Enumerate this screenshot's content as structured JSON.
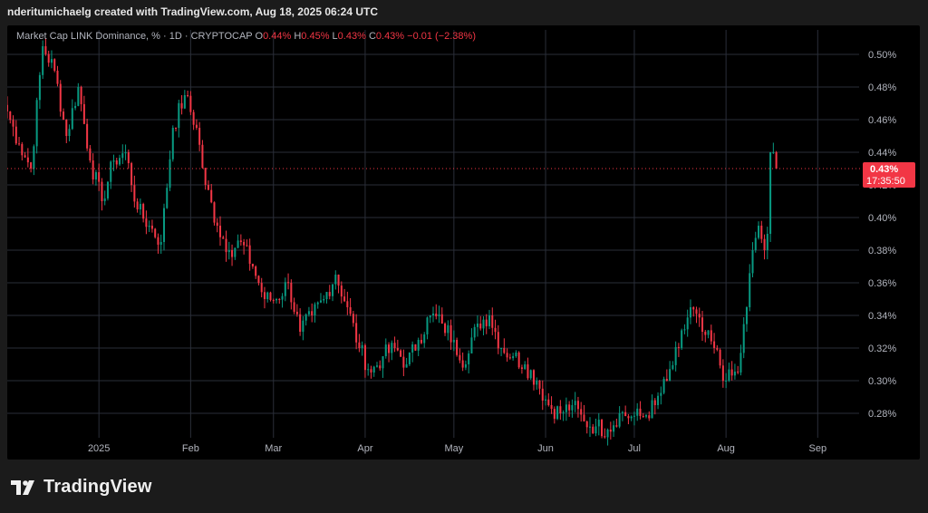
{
  "caption": "nderitumichaelg created with TradingView.com, Aug 18, 2025 06:24 UTC",
  "legend": {
    "symbol": "Market Cap LINK Dominance, % · 1D · CRYPTOCAP",
    "o_label": "O",
    "o_value": "0.44%",
    "h_label": "H",
    "h_value": "0.45%",
    "l_label": "L",
    "l_value": "0.43%",
    "c_label": "C",
    "c_value": "0.43%",
    "change": "−0.01 (−2.38%)"
  },
  "price_tag": {
    "value": "0.43%",
    "countdown": "17:35:50"
  },
  "brand": {
    "name": "TradingView"
  },
  "colors": {
    "up": "#089981",
    "down": "#f23645",
    "grid": "#2a2e39",
    "background": "#000000",
    "text": "#b2b5be"
  },
  "chart_data": {
    "type": "candlestick",
    "title": "Market Cap LINK Dominance, %",
    "interval": "1D",
    "y_unit": "%",
    "ylim": [
      0.265,
      0.515
    ],
    "y_ticks": [
      "0.28%",
      "0.30%",
      "0.32%",
      "0.34%",
      "0.36%",
      "0.38%",
      "0.40%",
      "0.42%",
      "0.44%",
      "0.46%",
      "0.48%",
      "0.50%"
    ],
    "x_ticks": [
      "2025",
      "Feb",
      "Mar",
      "Apr",
      "May",
      "Jun",
      "Jul",
      "Aug",
      "Sep"
    ],
    "last_price": 0.43,
    "grid": true,
    "close_series": [
      {
        "date": "2024-12-01",
        "close": 0.465
      },
      {
        "date": "2024-12-05",
        "close": 0.445
      },
      {
        "date": "2024-12-09",
        "close": 0.43
      },
      {
        "date": "2024-12-13",
        "close": 0.505
      },
      {
        "date": "2024-12-17",
        "close": 0.49
      },
      {
        "date": "2024-12-21",
        "close": 0.45
      },
      {
        "date": "2024-12-25",
        "close": 0.48
      },
      {
        "date": "2024-12-29",
        "close": 0.435
      },
      {
        "date": "2025-01-02",
        "close": 0.41
      },
      {
        "date": "2025-01-06",
        "close": 0.435
      },
      {
        "date": "2025-01-10",
        "close": 0.44
      },
      {
        "date": "2025-01-14",
        "close": 0.405
      },
      {
        "date": "2025-01-18",
        "close": 0.395
      },
      {
        "date": "2025-01-22",
        "close": 0.385
      },
      {
        "date": "2025-01-26",
        "close": 0.455
      },
      {
        "date": "2025-01-30",
        "close": 0.475
      },
      {
        "date": "2025-02-03",
        "close": 0.455
      },
      {
        "date": "2025-02-06",
        "close": 0.42
      },
      {
        "date": "2025-02-10",
        "close": 0.395
      },
      {
        "date": "2025-02-14",
        "close": 0.38
      },
      {
        "date": "2025-02-18",
        "close": 0.385
      },
      {
        "date": "2025-02-22",
        "close": 0.37
      },
      {
        "date": "2025-02-26",
        "close": 0.35
      },
      {
        "date": "2025-03-02",
        "close": 0.35
      },
      {
        "date": "2025-03-06",
        "close": 0.36
      },
      {
        "date": "2025-03-10",
        "close": 0.33
      },
      {
        "date": "2025-03-14",
        "close": 0.34
      },
      {
        "date": "2025-03-18",
        "close": 0.35
      },
      {
        "date": "2025-03-22",
        "close": 0.365
      },
      {
        "date": "2025-03-26",
        "close": 0.345
      },
      {
        "date": "2025-03-30",
        "close": 0.32
      },
      {
        "date": "2025-04-03",
        "close": 0.305
      },
      {
        "date": "2025-04-07",
        "close": 0.315
      },
      {
        "date": "2025-04-11",
        "close": 0.32
      },
      {
        "date": "2025-04-15",
        "close": 0.31
      },
      {
        "date": "2025-04-19",
        "close": 0.325
      },
      {
        "date": "2025-04-23",
        "close": 0.34
      },
      {
        "date": "2025-04-27",
        "close": 0.335
      },
      {
        "date": "2025-05-01",
        "close": 0.325
      },
      {
        "date": "2025-05-05",
        "close": 0.31
      },
      {
        "date": "2025-05-09",
        "close": 0.335
      },
      {
        "date": "2025-05-13",
        "close": 0.34
      },
      {
        "date": "2025-05-17",
        "close": 0.32
      },
      {
        "date": "2025-05-21",
        "close": 0.315
      },
      {
        "date": "2025-05-25",
        "close": 0.31
      },
      {
        "date": "2025-05-29",
        "close": 0.3
      },
      {
        "date": "2025-06-02",
        "close": 0.285
      },
      {
        "date": "2025-06-06",
        "close": 0.28
      },
      {
        "date": "2025-06-10",
        "close": 0.285
      },
      {
        "date": "2025-06-14",
        "close": 0.275
      },
      {
        "date": "2025-06-18",
        "close": 0.272
      },
      {
        "date": "2025-06-22",
        "close": 0.27
      },
      {
        "date": "2025-06-26",
        "close": 0.28
      },
      {
        "date": "2025-06-30",
        "close": 0.278
      },
      {
        "date": "2025-07-04",
        "close": 0.278
      },
      {
        "date": "2025-07-08",
        "close": 0.285
      },
      {
        "date": "2025-07-12",
        "close": 0.3
      },
      {
        "date": "2025-07-16",
        "close": 0.32
      },
      {
        "date": "2025-07-20",
        "close": 0.345
      },
      {
        "date": "2025-07-24",
        "close": 0.33
      },
      {
        "date": "2025-07-28",
        "close": 0.32
      },
      {
        "date": "2025-08-01",
        "close": 0.3
      },
      {
        "date": "2025-08-05",
        "close": 0.305
      },
      {
        "date": "2025-08-08",
        "close": 0.345
      },
      {
        "date": "2025-08-10",
        "close": 0.38
      },
      {
        "date": "2025-08-12",
        "close": 0.395
      },
      {
        "date": "2025-08-14",
        "close": 0.38
      },
      {
        "date": "2025-08-15",
        "close": 0.39
      },
      {
        "date": "2025-08-16",
        "close": 0.44
      },
      {
        "date": "2025-08-17",
        "close": 0.44
      },
      {
        "date": "2025-08-18",
        "close": 0.43
      }
    ]
  }
}
